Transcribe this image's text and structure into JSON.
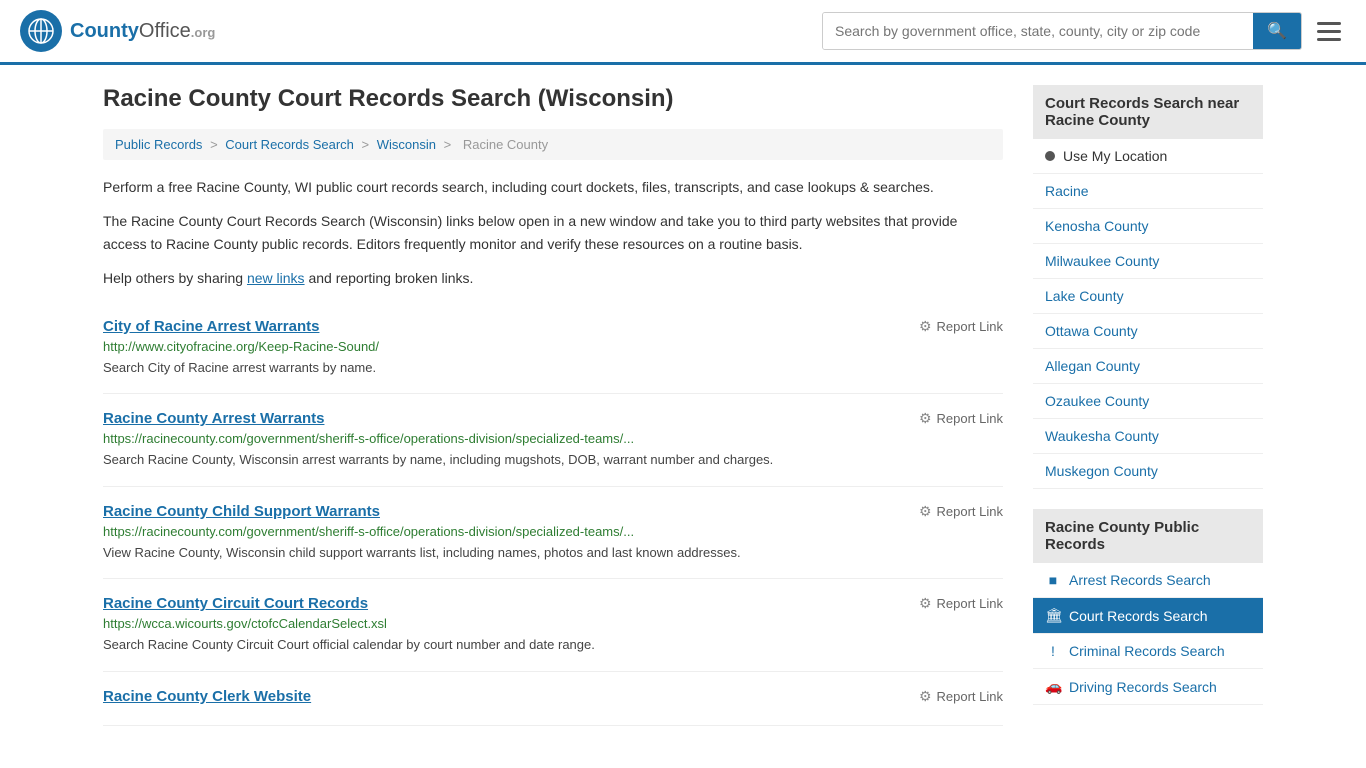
{
  "header": {
    "logo_icon": "🌐",
    "logo_name": "County",
    "logo_suffix": "Office",
    "logo_org": ".org",
    "search_placeholder": "Search by government office, state, county, city or zip code",
    "search_value": ""
  },
  "page": {
    "title": "Racine County Court Records Search (Wisconsin)"
  },
  "breadcrumb": {
    "items": [
      "Public Records",
      "Court Records Search",
      "Wisconsin",
      "Racine County"
    ]
  },
  "description": {
    "para1": "Perform a free Racine County, WI public court records search, including court dockets, files, transcripts, and case lookups & searches.",
    "para2": "The Racine County Court Records Search (Wisconsin) links below open in a new window and take you to third party websites that provide access to Racine County public records. Editors frequently monitor and verify these resources on a routine basis.",
    "para3_prefix": "Help others by sharing ",
    "para3_link": "new links",
    "para3_suffix": " and reporting broken links."
  },
  "results": [
    {
      "title": "City of Racine Arrest Warrants",
      "url": "http://www.cityofracine.org/Keep-Racine-Sound/",
      "description": "Search City of Racine arrest warrants by name.",
      "report_label": "Report Link"
    },
    {
      "title": "Racine County Arrest Warrants",
      "url": "https://racinecounty.com/government/sheriff-s-office/operations-division/specialized-teams/...",
      "description": "Search Racine County, Wisconsin arrest warrants by name, including mugshots, DOB, warrant number and charges.",
      "report_label": "Report Link"
    },
    {
      "title": "Racine County Child Support Warrants",
      "url": "https://racinecounty.com/government/sheriff-s-office/operations-division/specialized-teams/...",
      "description": "View Racine County, Wisconsin child support warrants list, including names, photos and last known addresses.",
      "report_label": "Report Link"
    },
    {
      "title": "Racine County Circuit Court Records",
      "url": "https://wcca.wicourts.gov/ctofcCalendarSelect.xsl",
      "description": "Search Racine County Circuit Court official calendar by court number and date range.",
      "report_label": "Report Link"
    },
    {
      "title": "Racine County Clerk Website",
      "url": "",
      "description": "",
      "report_label": "Report Link"
    }
  ],
  "sidebar": {
    "nearby_header": "Court Records Search near Racine County",
    "use_my_location": "Use My Location",
    "nearby_links": [
      "Racine",
      "Kenosha County",
      "Milwaukee County",
      "Lake County",
      "Ottawa County",
      "Allegan County",
      "Ozaukee County",
      "Waukesha County",
      "Muskegon County"
    ],
    "public_records_header": "Racine County Public Records",
    "public_records_links": [
      {
        "label": "Arrest Records Search",
        "icon": "■",
        "active": false
      },
      {
        "label": "Court Records Search",
        "icon": "🏛",
        "active": true
      },
      {
        "label": "Criminal Records Search",
        "icon": "!",
        "active": false
      },
      {
        "label": "Driving Records Search",
        "icon": "🚗",
        "active": false
      }
    ]
  }
}
